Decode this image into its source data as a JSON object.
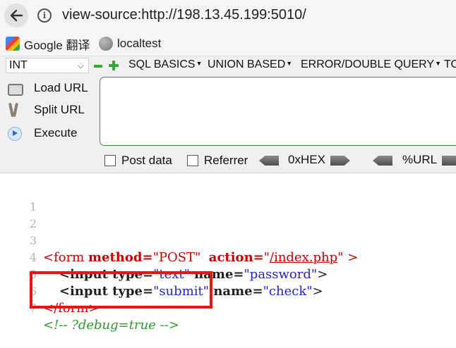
{
  "address_bar": {
    "url": "view-source:http://198.13.45.199:5010/"
  },
  "bookmarks": [
    {
      "label": "Google 翻译",
      "icon": "google-logo-icon"
    },
    {
      "label": "localtest",
      "icon": "globe-icon"
    }
  ],
  "hackbar": {
    "select_value": "INT",
    "menus": [
      "SQL BASICS",
      "UNION BASED",
      "ERROR/DOUBLE QUERY",
      "TO"
    ],
    "buttons": {
      "load": "Load URL",
      "split": "Split URL",
      "execute": "Execute"
    },
    "options": {
      "post": "Post data",
      "referrer": "Referrer"
    },
    "encoders": [
      "0xHEX",
      "%URL"
    ],
    "url_value": ""
  },
  "source": {
    "line_numbers": [
      "1",
      "2",
      "3",
      "4",
      "5",
      "6",
      "7"
    ],
    "line3": {
      "open": "<form ",
      "method_attr": "method=",
      "method_val": "\"POST\"",
      "gap": "  ",
      "action_attr": "action=",
      "q1": "\"",
      "action_val": "/index.php",
      "q2": "\"",
      "close": " >"
    },
    "line4": {
      "indent": "    ",
      "open": "<input ",
      "type_attr": "type=",
      "type_val": "\"text\"",
      "name_attr": " name=",
      "name_val": "\"password\"",
      "close": ">"
    },
    "line5": {
      "indent": "    ",
      "open": "<input ",
      "type_attr": "type=",
      "type_val": "\"submit\"",
      "name_attr": " name=",
      "name_val": "\"check\"",
      "close": ">"
    },
    "line6": {
      "text": "</form>"
    },
    "line7": {
      "text": "<!-- ?debug=true -->"
    }
  },
  "colors": {
    "tag": "#cc0000",
    "value": "#2222cc",
    "comment": "#2e9a2e",
    "highlight": "#ee1111",
    "hackbar_border": "#3f8f3f"
  }
}
